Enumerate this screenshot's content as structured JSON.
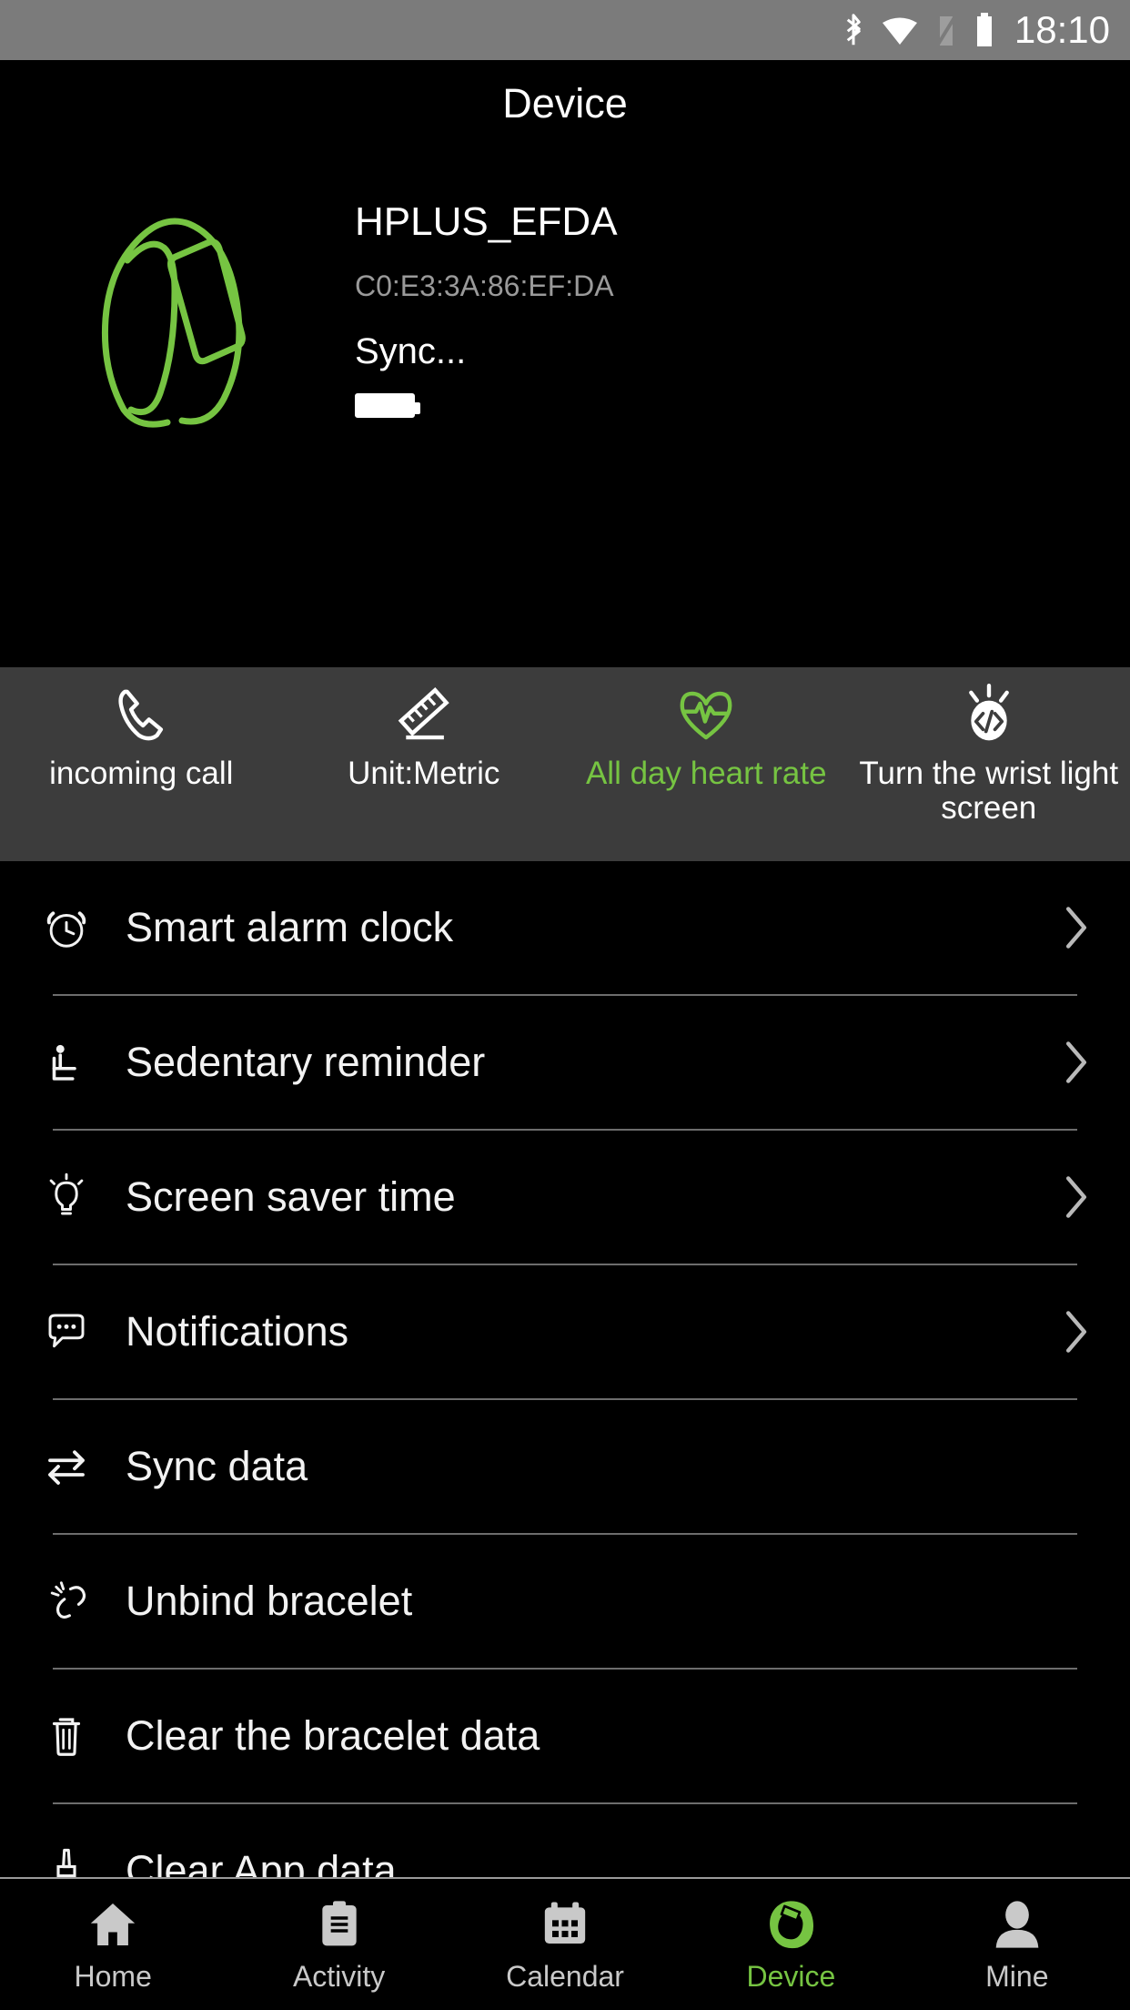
{
  "statusbar": {
    "time": "18:10",
    "icons": [
      "bluetooth-icon",
      "wifi-icon",
      "signal-off-icon",
      "battery-icon"
    ]
  },
  "header": {
    "title": "Device"
  },
  "device": {
    "image": "bracelet-outline-illustration",
    "name": "HPLUS_EFDA",
    "mac": "C0:E3:3A:86:EF:DA",
    "status": "Sync...",
    "battery_icon": "battery-full-icon",
    "accent_color": "#76c442"
  },
  "tiles": [
    {
      "label": "incoming call",
      "icon": "phone-icon",
      "active": false
    },
    {
      "label": "Unit:Metric",
      "icon": "ruler-icon",
      "active": false
    },
    {
      "label": "All day heart rate",
      "icon": "heart-pulse-icon",
      "active": true
    },
    {
      "label": "Turn the wrist light screen",
      "icon": "wrist-light-icon",
      "active": false
    }
  ],
  "settings": [
    {
      "label": "Smart alarm clock",
      "icon": "alarm-clock-icon",
      "chevron": true
    },
    {
      "label": "Sedentary reminder",
      "icon": "sedentary-icon",
      "chevron": true
    },
    {
      "label": "Screen saver time",
      "icon": "lightbulb-icon",
      "chevron": true
    },
    {
      "label": "Notifications",
      "icon": "message-bubble-icon",
      "chevron": true
    },
    {
      "label": "Sync data",
      "icon": "sync-arrows-icon",
      "chevron": false
    },
    {
      "label": "Unbind bracelet",
      "icon": "unbind-icon",
      "chevron": false
    },
    {
      "label": "Clear the bracelet data",
      "icon": "trash-icon",
      "chevron": false
    },
    {
      "label": "Clear App data",
      "icon": "brush-icon",
      "chevron": false
    }
  ],
  "bottomnav": [
    {
      "label": "Home",
      "icon": "home-icon",
      "active": false
    },
    {
      "label": "Activity",
      "icon": "clipboard-icon",
      "active": false
    },
    {
      "label": "Calendar",
      "icon": "calendar-icon",
      "active": false
    },
    {
      "label": "Device",
      "icon": "bracelet-icon",
      "active": true
    },
    {
      "label": "Mine",
      "icon": "person-icon",
      "active": false
    }
  ]
}
